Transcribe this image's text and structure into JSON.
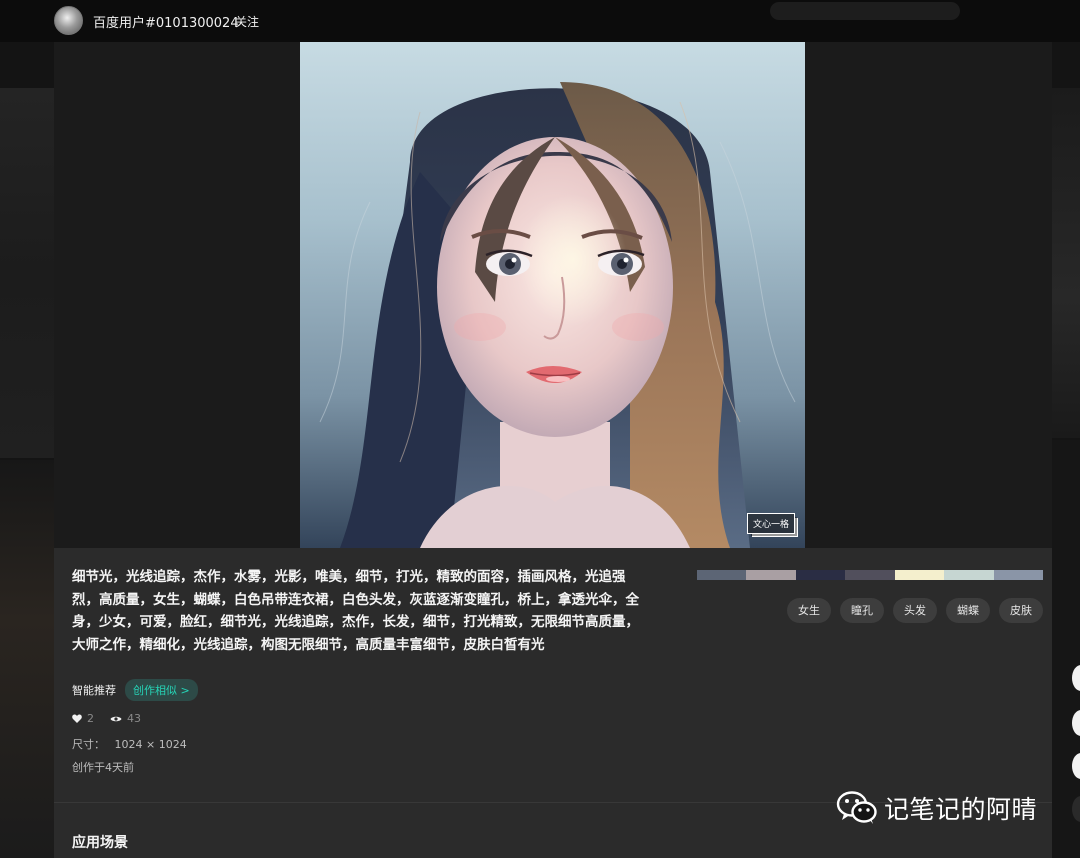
{
  "header": {
    "username": "百度用户#0101300024",
    "follow_label": "关注"
  },
  "artwork": {
    "watermark": "文心一格"
  },
  "details": {
    "prompt": "细节光，光线追踪，杰作，水雾，光影，唯美，细节，打光，精致的面容，插画风格，光追强烈，高质量，女生，蝴蝶，白色吊带连衣裙，白色头发，灰蓝逐渐变瞳孔，桥上，拿透光伞，全身，少女，可爱，脸红，细节光，光线追踪，杰作，长发，细节，打光精致，无限细节高质量，大师之作，精细化，光线追踪，构图无限细节，高质量丰富细节，皮肤白皙有光",
    "recommend_label": "智能推荐",
    "create_similar": "创作相似 >",
    "likes": "2",
    "views": "43",
    "size_label": "尺寸：",
    "size_value": "1024 × 1024",
    "created": "创作于4天前"
  },
  "palette": [
    "#5c6575",
    "#a99fa3",
    "#2a2d44",
    "#514f5c",
    "#f4efcd",
    "#c6d6d2",
    "#8a95a7"
  ],
  "tags": [
    "女生",
    "瞳孔",
    "头发",
    "蝴蝶",
    "皮肤"
  ],
  "sections": {
    "applications": "应用场景"
  },
  "brand": {
    "text": "记笔记的阿晴"
  }
}
